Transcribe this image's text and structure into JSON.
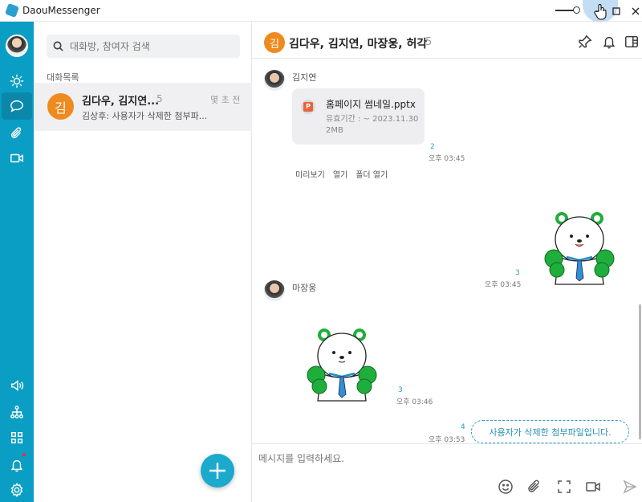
{
  "app": {
    "title": "DaouMessenger"
  },
  "search": {
    "placeholder": "대화방, 참여자 검색"
  },
  "list": {
    "section_label": "대화목록",
    "rooms": [
      {
        "avatar_text": "김",
        "name": "김다우, 김지연...",
        "count": "5",
        "time": "몇 초 전",
        "preview": "김상후: 사용자가 삭제한 첨부파...",
        "avatar_color": "#ee8a1e"
      }
    ]
  },
  "chat": {
    "avatar_text": "김",
    "title": "김다우, 김지연, 마장웅, 허각",
    "member_count": "5",
    "messages": {
      "m1": {
        "sender": "김지연",
        "file_name": "홈페이지 썸네일.pptx",
        "file_icon": "P",
        "expiry": "유효기간 : ~ 2023.11.30",
        "size": "2MB",
        "read": "2",
        "time": "오후 03:45",
        "actions": [
          "미리보기",
          "열기",
          "폴더 열기"
        ]
      },
      "m2": {
        "read": "3",
        "time": "오후 03:45"
      },
      "m3": {
        "sender": "마장웅",
        "read": "3",
        "time": "오후 03:46"
      },
      "m4": {
        "read": "4",
        "time": "오후 03:53",
        "text": "사용자가 삭제한 첨부파일입니다."
      }
    },
    "composer_placeholder": "메시지를 입력하세요."
  },
  "colors": {
    "rail": "#0a9ec4",
    "accent": "#2aa0c5",
    "avatar_orange": "#ee8a1e"
  }
}
